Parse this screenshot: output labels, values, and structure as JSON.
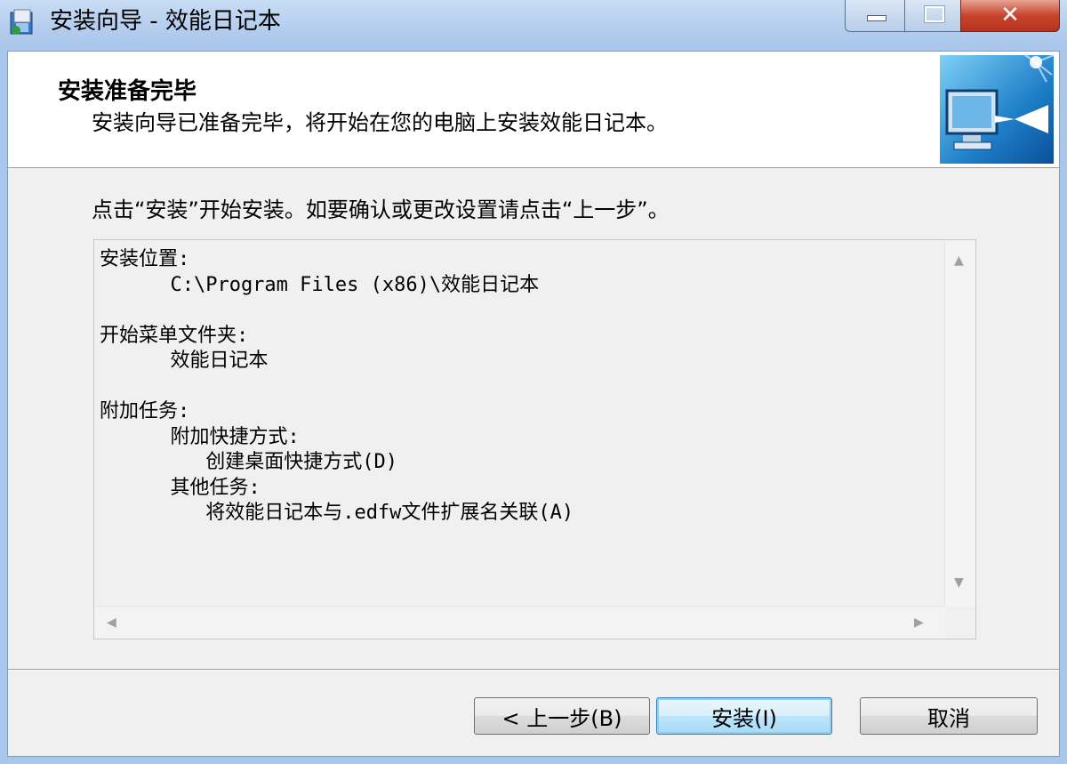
{
  "window": {
    "title": "安装向导 - 效能日记本",
    "controls": {
      "minimize": "minimize-button",
      "maximize": "maximize-button",
      "close": "close-button"
    }
  },
  "header": {
    "title": "安装准备完毕",
    "subtitle": "安装向导已准备完毕，将开始在您的电脑上安装效能日记本。",
    "image_icon": "computer-install-icon"
  },
  "body": {
    "instruction": "点击“安装”开始安装。如要确认或更改设置请点击“上一步”。"
  },
  "summary": {
    "lines": [
      "安装位置:",
      "      C:\\Program Files (x86)\\效能日记本",
      "",
      "开始菜单文件夹:",
      "      效能日记本",
      "",
      "附加任务:",
      "      附加快捷方式:",
      "         创建桌面快捷方式(D)",
      "      其他任务:",
      "         将效能日记本与.edfw文件扩展名关联(A)"
    ]
  },
  "buttons": {
    "back": "< 上一步(B)",
    "install": "安装(I)",
    "cancel": "取消"
  },
  "colors": {
    "titlebar": "#a8c5ea",
    "close_button": "#c7442c",
    "default_button_border": "#3c7fb1"
  }
}
